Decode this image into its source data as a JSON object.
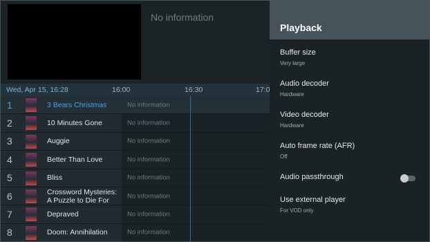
{
  "guide": {
    "info_text": "No information",
    "timeline": {
      "date": "Wed, Apr 15, 16:28",
      "ticks": [
        "16:00",
        "16:30",
        "17:0"
      ]
    },
    "channels": [
      {
        "num": "1",
        "name": "3 Bears Christmas",
        "program": "No information",
        "selected": true
      },
      {
        "num": "2",
        "name": "10 Minutes Gone",
        "program": "No information"
      },
      {
        "num": "3",
        "name": "Auggie",
        "program": "No information"
      },
      {
        "num": "4",
        "name": "Better Than Love",
        "program": "No information"
      },
      {
        "num": "5",
        "name": "Bliss",
        "program": "No information"
      },
      {
        "num": "6",
        "name": "Crossword Mysteries: A Puzzle to Die For",
        "program": "No information"
      },
      {
        "num": "7",
        "name": "Depraved",
        "program": "No information"
      },
      {
        "num": "8",
        "name": "Doom: Annihilation",
        "program": "No information"
      }
    ]
  },
  "panel": {
    "title": "Playback",
    "settings": [
      {
        "label": "Buffer size",
        "value": "Very large"
      },
      {
        "label": "Audio decoder",
        "value": "Hardware"
      },
      {
        "label": "Video decoder",
        "value": "Hardware"
      },
      {
        "label": "Auto frame rate (AFR)",
        "value": "Off"
      },
      {
        "label": "Audio passthrough",
        "toggle": false
      },
      {
        "label": "Use external player",
        "value": "For VOD only"
      }
    ]
  },
  "colors": {
    "accent": "#4ba3e0",
    "panel_header": "#46535a",
    "panel_bg": "#1b2226"
  }
}
